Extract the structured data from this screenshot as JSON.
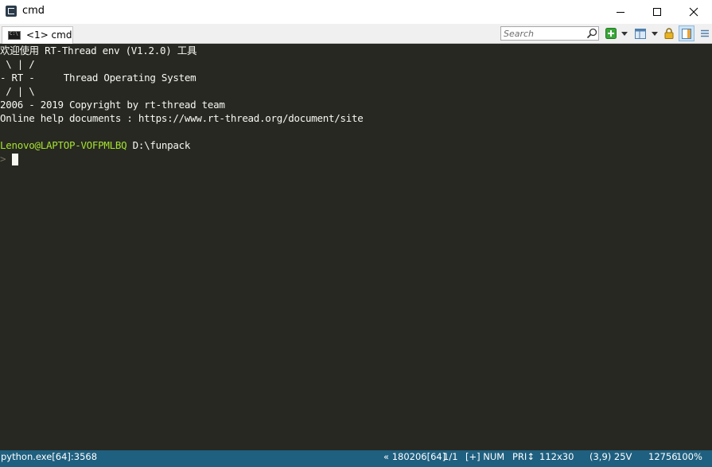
{
  "window": {
    "title": "cmd"
  },
  "tab": {
    "label": "<1> cmd"
  },
  "toolbar": {
    "search_placeholder": "Search"
  },
  "console": {
    "lines": [
      "欢迎使用 RT-Thread env (V1.2.0) 工具",
      " \\ | /",
      "- RT -     Thread Operating System",
      " / | \\",
      "2006 - 2019 Copyright by rt-thread team",
      "Online help documents : https://www.rt-thread.org/document/site"
    ],
    "prompt_user": "Lenovo@LAPTOP-VOFPMLBQ",
    "prompt_path": "D:\\funpack",
    "prompt_symbol": ">"
  },
  "statusbar": {
    "process": "python.exe[64]:3568",
    "build": "« 180206[64]",
    "console_index": "1/1",
    "keys": "[+] NUM",
    "priority": "PRI↕",
    "size": "112x30",
    "cursor": "(3,9) 25V",
    "pid": "12756",
    "zoom": "100%"
  }
}
